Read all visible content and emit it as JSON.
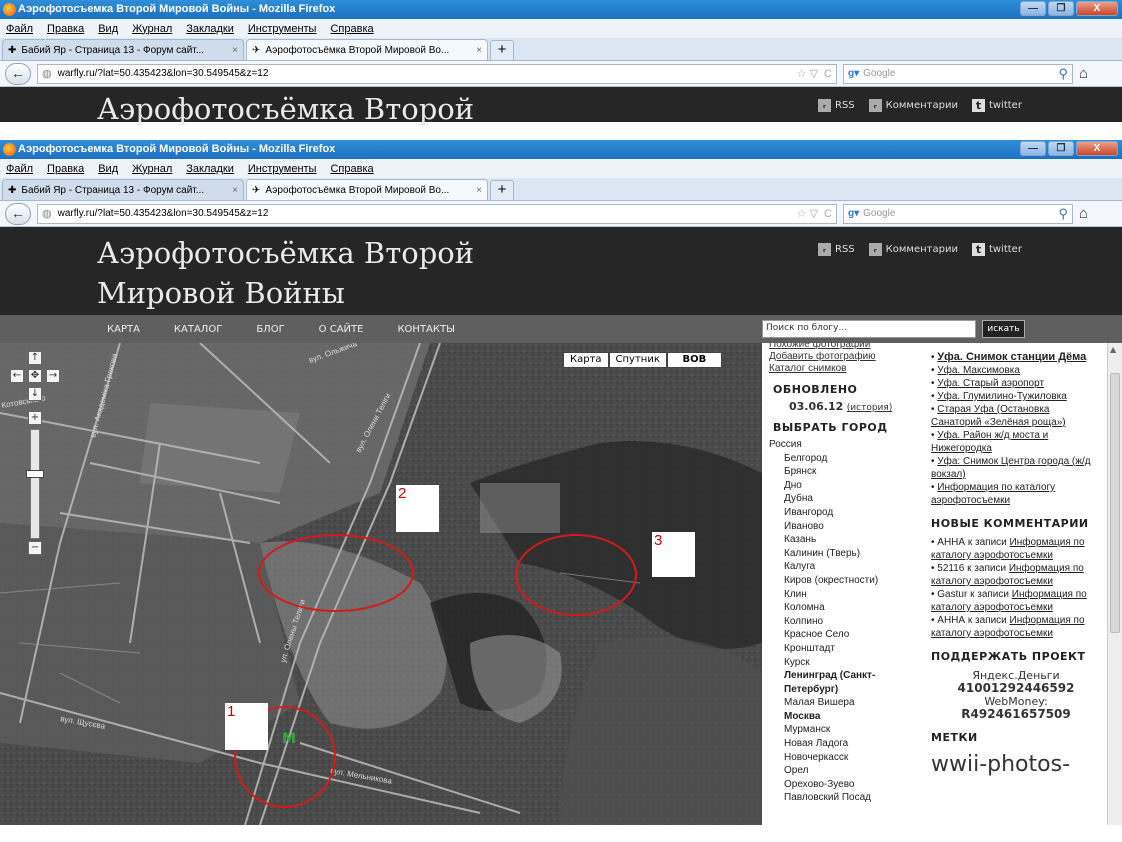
{
  "browser": {
    "window_title": "Аэрофотосъемка Второй Мировой Войны - Mozilla Firefox",
    "menu": [
      "Файл",
      "Правка",
      "Вид",
      "Журнал",
      "Закладки",
      "Инструменты",
      "Справка"
    ],
    "tabs": [
      {
        "label": "Бабий Яр - Страница 13 - Форум сайт...",
        "close": "×"
      },
      {
        "label": "Аэрофотосъёмка Второй Мировой Во...",
        "close": "×"
      }
    ],
    "new_tab": "+",
    "url": "warfly.ru/?lat=50.435423&lon=30.549545&z=12",
    "search_placeholder": "Google",
    "buttons": {
      "minimize": "—",
      "maximize": "❐",
      "close": "X",
      "back": "←",
      "reload": "C",
      "star": "☆ ▽",
      "home": "⌂",
      "magnifier": "⚲"
    }
  },
  "site": {
    "title_line1": "Аэрофотосъёмка Второй",
    "title_line2": "Мировой Войны",
    "toplinks": {
      "rss": "RSS",
      "comments": "Комментарии",
      "twitter": "twitter"
    },
    "nav": [
      "КАРТА",
      "КАТАЛОГ",
      "БЛОГ",
      "О САЙТЕ",
      "КОНТАКТЫ"
    ],
    "search_placeholder": "Поиск по блогу...",
    "search_button": "искать"
  },
  "map": {
    "types": [
      "Карта",
      "Спутник",
      "ВОВ"
    ],
    "selected_type": "ВОВ",
    "markers": [
      "1",
      "2",
      "3"
    ],
    "labels": [
      "вул. Олени Теліги",
      "вул. Щусєва",
      "вул. Мельникова",
      "вул. Ольжича",
      "вул. Академіка Грекова",
      "Котовського",
      "ул. Олены Телиги"
    ]
  },
  "sidebar_left": {
    "links_top": [
      "Похожие фотографии",
      "Добавить фотографию",
      "Каталог снимков"
    ],
    "updated_heading": "ОБНОВЛЕНО",
    "updated_date": "03.06.12",
    "updated_history": "(история)",
    "city_heading": "ВЫБРАТЬ ГОРОД",
    "country": "Россия",
    "cities": [
      "Белгород",
      "Брянск",
      "Дно",
      "Дубна",
      "Ивангород",
      "Иваново",
      "Казань",
      "Калинин (Тверь)",
      "Калуга",
      "Киров (окрестности)",
      "Клин",
      "Коломна",
      "Колпино",
      "Красное Село",
      "Кронштадт",
      "Курск",
      "Ленинград (Санкт-Петербург)",
      "Малая Вишера",
      "Москва",
      "Мурманск",
      "Новая Ладога",
      "Новочеркасск",
      "Орел",
      "Орехово-Зуево",
      "Павловский Посад"
    ],
    "bold_cities": [
      "Ленинград (Санкт-Петербург)",
      "Москва"
    ]
  },
  "sidebar_right": {
    "recent": [
      {
        "text": "Уфа. Снимок станции Дёма",
        "bold": true
      },
      {
        "text": "Уфа. Максимовка",
        "bold": false
      },
      {
        "text": "Уфа. Старый аэропорт",
        "bold": false
      },
      {
        "text": "Уфа. Глумилино-Тужиловка",
        "bold": false
      },
      {
        "text": "Старая Уфа (Остановка Санаторий «Зелёная роща»)",
        "bold": false
      },
      {
        "text": "Уфа. Район ж/д моста и Нижегородка",
        "bold": false
      },
      {
        "text": "Уфа: Снимок Центра города (ж/д вокзал)",
        "bold": false
      },
      {
        "text": "Информация по каталогу аэрофотосъемки",
        "bold": false
      }
    ],
    "comments_heading": "НОВЫЕ КОММЕНТАРИИ",
    "comments": [
      {
        "author": "АННА",
        "mid": "к записи",
        "link": "Информация по каталогу аэрофотосъемки"
      },
      {
        "author": "52116",
        "mid": "к записи",
        "link": "Информация по каталогу аэрофотосъемки"
      },
      {
        "author": "Gastur",
        "mid": "к записи",
        "link": "Информация по каталогу аэрофотосъемки"
      },
      {
        "author": "АННА",
        "mid": "к записи",
        "link": "Информация по каталогу аэрофотосъемки"
      }
    ],
    "support_heading": "ПОДДЕРЖАТЬ ПРОЕКТ",
    "yandex_label": "Яндекс.Деньги",
    "yandex_value": "41001292446592",
    "webmoney_label": "WebMoney:",
    "webmoney_value": "R492461657509",
    "tags_heading": "МЕТКИ",
    "tags_image_text": "wwii-photos-"
  }
}
